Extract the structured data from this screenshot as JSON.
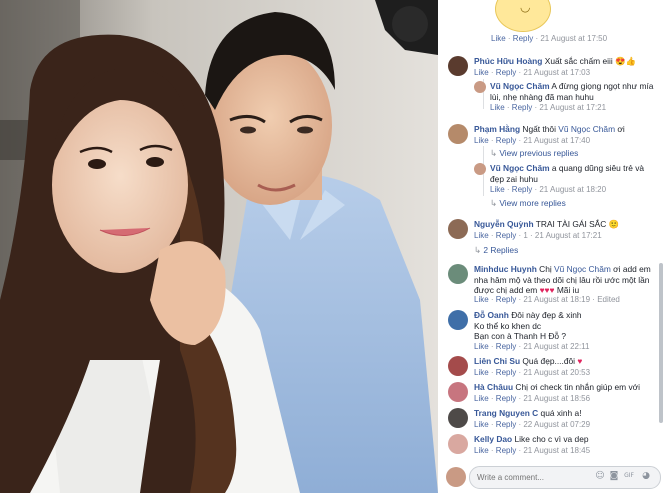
{
  "top_meta": {
    "like": "Like",
    "sep": " · ",
    "reply": "Reply",
    "time": " · 21 August at 17:50"
  },
  "comments": [
    {
      "name": "Phúc Hữu Hoàng",
      "text": " Xuất sắc chấm eiii",
      "emoji": "😍👍",
      "like": "Like",
      "reply": "Reply",
      "time": " · 21 August at 17:03"
    },
    {
      "name": "Vũ Ngọc Chăm",
      "text": " A đừng giọng ngọt như mía lùi, nhẹ nhàng đã man huhu",
      "like": "Like",
      "reply": "Reply",
      "time": " · 21 August at 17:21"
    },
    {
      "name": "Phạm Hằng",
      "text": " Ngất thôi ",
      "tag": "Vũ Ngọc Chăm",
      "tail": " ơi",
      "like": "Like",
      "reply": "Reply",
      "time": " · 21 August at 17:40"
    },
    {
      "name": "Vũ Ngọc Chăm",
      "text": " a quang dũng siêu trẻ và đẹp zai huhu",
      "like": "Like",
      "reply": "Reply",
      "time": " · 21 August at 18:20"
    },
    {
      "name": "Nguyễn Quỳnh",
      "text": " TRAI TÀI GÁI SẮC",
      "emoji": "🙂",
      "like": "Like",
      "reply": "Reply",
      "time": " · 1 · 21 August at 17:21"
    },
    {
      "name": "Minhduc Huynh",
      "text": " Chị ",
      "tag": "Vũ Ngọc Chăm",
      "tail": " ơi add em nha hâm mộ và theo dõi chị lâu rồi ước một lần được chị add em ",
      "hearts": "♥♥♥",
      "tail2": " Mãi iu",
      "like": "Like",
      "reply": "Reply",
      "time": " · 21 August at 18:19 · Edited"
    },
    {
      "name": "Đỗ Oanh",
      "text": " Đôi này đẹp & xinh",
      "line2": "Ko thể ko khen dc",
      "line3": "Bạn con à Thanh H Đỗ ?",
      "like": "Like",
      "reply": "Reply",
      "time": " · 21 August at 22:11"
    },
    {
      "name": "Liên Chi Su",
      "text": " Quá đẹp....đôi ",
      "hearts": "♥",
      "like": "Like",
      "reply": "Reply",
      "time": " · 21 August at 20:53"
    },
    {
      "name": "Hà Châuu",
      "text": " Chị ơi check tin nhắn giúp em với",
      "like": "Like",
      "reply": "Reply",
      "time": " · 21 August at 18:56"
    },
    {
      "name": "Trang Nguyen C",
      "text": " quá xinh a!",
      "like": "Like",
      "reply": "Reply",
      "time": " · 22 August at 07:29"
    },
    {
      "name": "Kelly Dao",
      "text": " Like cho c vì va dep",
      "like": "Like",
      "reply": "Reply",
      "time": " · 21 August at 18:45"
    }
  ],
  "view_previous": "View previous replies",
  "view_more": "View more replies",
  "two_replies": "2 Replies",
  "input": {
    "placeholder": "Write a comment..."
  },
  "input_icons": [
    "emoji-icon",
    "camera-icon",
    "gif-icon",
    "sticker-icon"
  ],
  "colors": {
    "link": "#385898",
    "meta": "#90949c",
    "text": "#1d2129"
  }
}
